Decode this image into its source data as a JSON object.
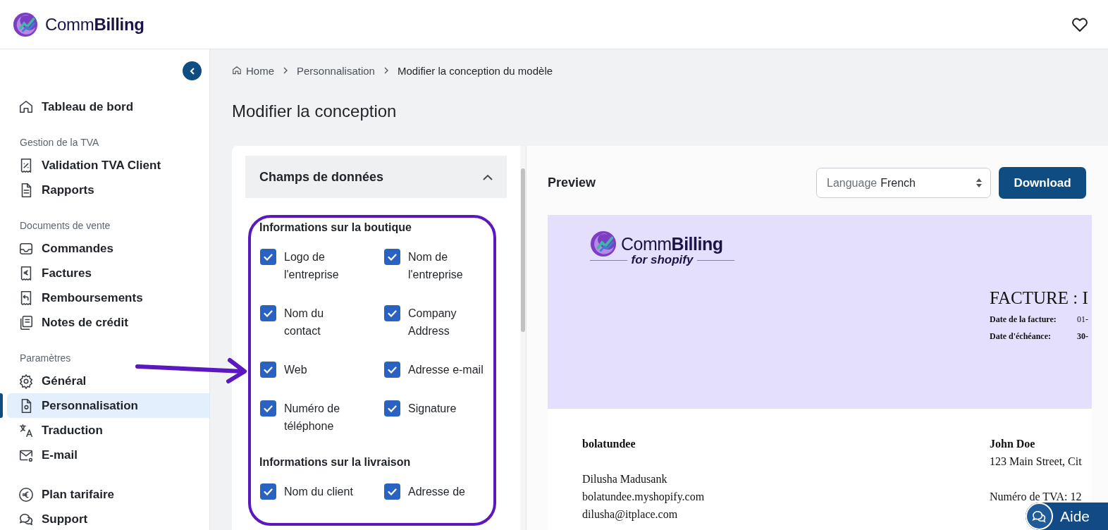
{
  "header": {
    "brand": {
      "light": "Comm",
      "bold": "Billing"
    }
  },
  "sidebar": {
    "groups": [
      {
        "items": [
          {
            "label": "Tableau de bord",
            "selected": false
          }
        ]
      },
      {
        "heading": "Gestion de la TVA",
        "items": [
          {
            "label": "Validation TVA Client",
            "selected": false
          },
          {
            "label": "Rapports",
            "selected": false
          }
        ]
      },
      {
        "heading": "Documents de vente",
        "items": [
          {
            "label": "Commandes",
            "selected": false
          },
          {
            "label": "Factures",
            "selected": false
          },
          {
            "label": "Remboursements",
            "selected": false
          },
          {
            "label": "Notes de crédit",
            "selected": false
          }
        ]
      },
      {
        "heading": "Paramètres",
        "items": [
          {
            "label": "Général",
            "selected": false
          },
          {
            "label": "Personnalisation",
            "selected": true
          },
          {
            "label": "Traduction",
            "selected": false
          },
          {
            "label": "E-mail",
            "selected": false
          }
        ]
      },
      {
        "items": [
          {
            "label": "Plan tarifaire",
            "selected": false
          },
          {
            "label": "Support",
            "selected": false
          }
        ]
      }
    ]
  },
  "breadcrumb": [
    "Home",
    "Personnalisation",
    "Modifier la conception du modèle"
  ],
  "page_title": "Modifier la conception",
  "fields_panel": {
    "title": "Champs de données",
    "expanded": true,
    "sections": [
      {
        "title": "Informations sur la boutique",
        "fields": [
          {
            "label": "Logo de l'entreprise",
            "checked": true
          },
          {
            "label": "Nom de l'entreprise",
            "checked": true
          },
          {
            "label": "Nom du contact",
            "checked": true
          },
          {
            "label": "Company Address",
            "checked": true
          },
          {
            "label": "Web",
            "checked": true
          },
          {
            "label": "Adresse e-mail",
            "checked": true
          },
          {
            "label": "Numéro de téléphone",
            "checked": true
          },
          {
            "label": "Signature",
            "checked": true
          }
        ]
      },
      {
        "title": "Informations sur la livraison",
        "fields": [
          {
            "label": "Nom du client",
            "checked": true
          },
          {
            "label": "Adresse de",
            "checked": true
          }
        ]
      }
    ]
  },
  "preview": {
    "title": "Preview",
    "language": {
      "label": "Language",
      "value": "French"
    },
    "download": "Download",
    "invoice": {
      "logo": {
        "light": "Comm",
        "bold": "Billing",
        "tagline": "for shopify"
      },
      "heading": "FACTURE : I",
      "dates": [
        {
          "label": "Date de la facture:",
          "value": "01-"
        },
        {
          "label": "Date d'échéance:",
          "value": "30-"
        }
      ],
      "seller": {
        "name": "bolatundee",
        "lines": [
          "Dilusha Madusank",
          "bolatundee.myshopify.com",
          "dilusha@itplace.com"
        ]
      },
      "buyer": {
        "name": "John Doe",
        "lines": [
          "123 Main Street, Cit",
          "Numéro de TVA: 12"
        ]
      }
    }
  },
  "help_button": "Aide"
}
